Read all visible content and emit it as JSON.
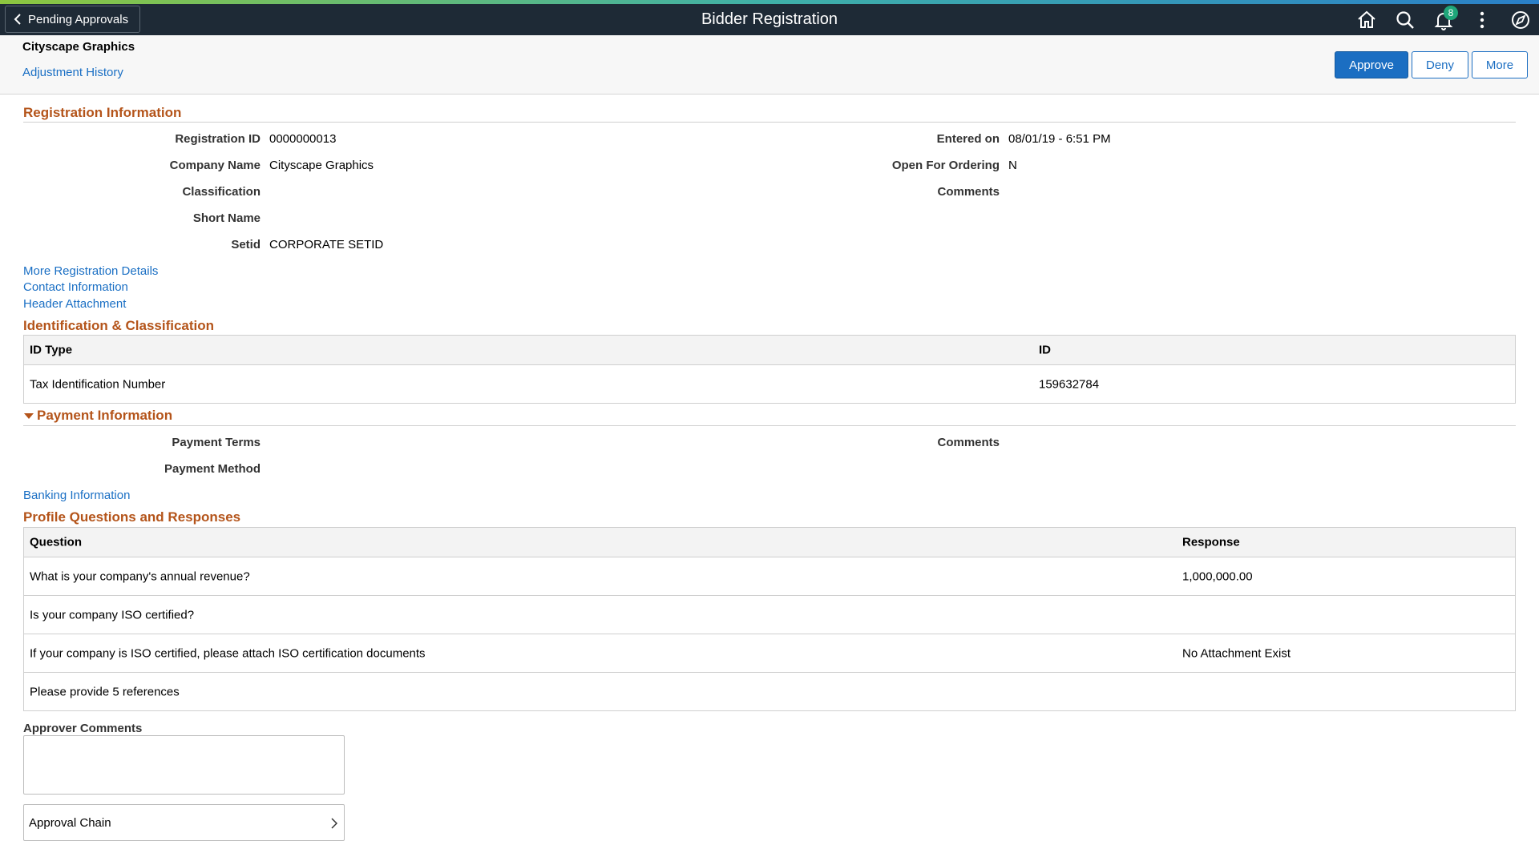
{
  "header": {
    "back_label": "Pending Approvals",
    "title": "Bidder Registration",
    "notification_count": "8",
    "icons": [
      "home-icon",
      "search-icon",
      "bell-icon",
      "more-vertical-icon",
      "compass-icon"
    ]
  },
  "page": {
    "company": "Cityscape Graphics",
    "adjustment_history": "Adjustment History",
    "buttons": {
      "approve": "Approve",
      "deny": "Deny",
      "more": "More"
    }
  },
  "registration": {
    "section_title": "Registration Information",
    "left": [
      {
        "label": "Registration ID",
        "value": "0000000013"
      },
      {
        "label": "Company Name",
        "value": "Cityscape Graphics"
      },
      {
        "label": "Classification",
        "value": ""
      },
      {
        "label": "Short Name",
        "value": ""
      },
      {
        "label": "Setid",
        "value": "CORPORATE SETID"
      }
    ],
    "right": [
      {
        "label": "Entered on",
        "value": "08/01/19 - 6:51 PM"
      },
      {
        "label": "Open For Ordering",
        "value": "N"
      },
      {
        "label": "Comments",
        "value": ""
      }
    ],
    "links": [
      "More Registration Details",
      "Contact Information",
      "Header Attachment"
    ]
  },
  "identification": {
    "section_title": "Identification & Classification",
    "columns": [
      "ID Type",
      "ID"
    ],
    "rows": [
      [
        "Tax Identification Number",
        "159632784"
      ]
    ]
  },
  "payment": {
    "section_title": "Payment Information",
    "left": [
      {
        "label": "Payment Terms",
        "value": ""
      },
      {
        "label": "Payment Method",
        "value": ""
      }
    ],
    "right": [
      {
        "label": "Comments",
        "value": ""
      }
    ],
    "banking_link": "Banking Information"
  },
  "profile": {
    "section_title": "Profile Questions and Responses",
    "columns": [
      "Question",
      "Response"
    ],
    "rows": [
      [
        "What is your company's annual revenue?",
        "1,000,000.00"
      ],
      [
        "Is your company ISO certified?",
        ""
      ],
      [
        "If your company is ISO certified, please attach ISO certification documents",
        "No Attachment Exist"
      ],
      [
        "Please provide 5 references",
        ""
      ]
    ]
  },
  "approver": {
    "comments_label": "Approver Comments",
    "comments_value": "",
    "approval_chain": "Approval Chain"
  }
}
